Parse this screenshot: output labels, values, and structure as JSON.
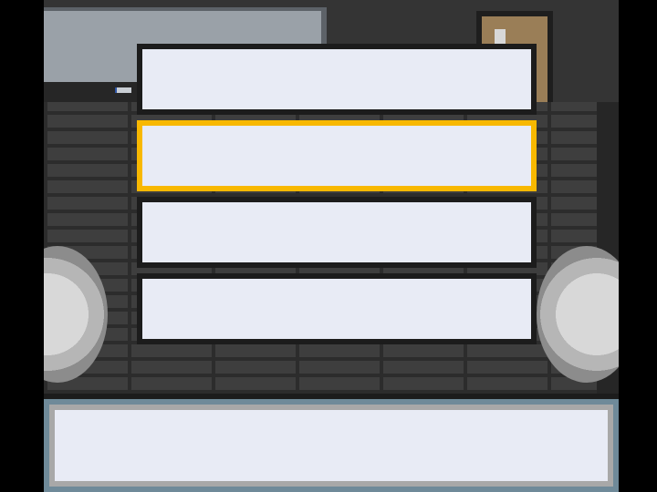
{
  "menu": {
    "selected_index": 1,
    "options": [
      {
        "label": ""
      },
      {
        "label": ""
      },
      {
        "label": ""
      },
      {
        "label": ""
      }
    ]
  },
  "message_box": {
    "text": ""
  },
  "colors": {
    "selection_border": "#f8b800",
    "box_fill": "#e8ebf5",
    "box_border": "#1c1c1c",
    "message_frame": "#6f8a99"
  }
}
